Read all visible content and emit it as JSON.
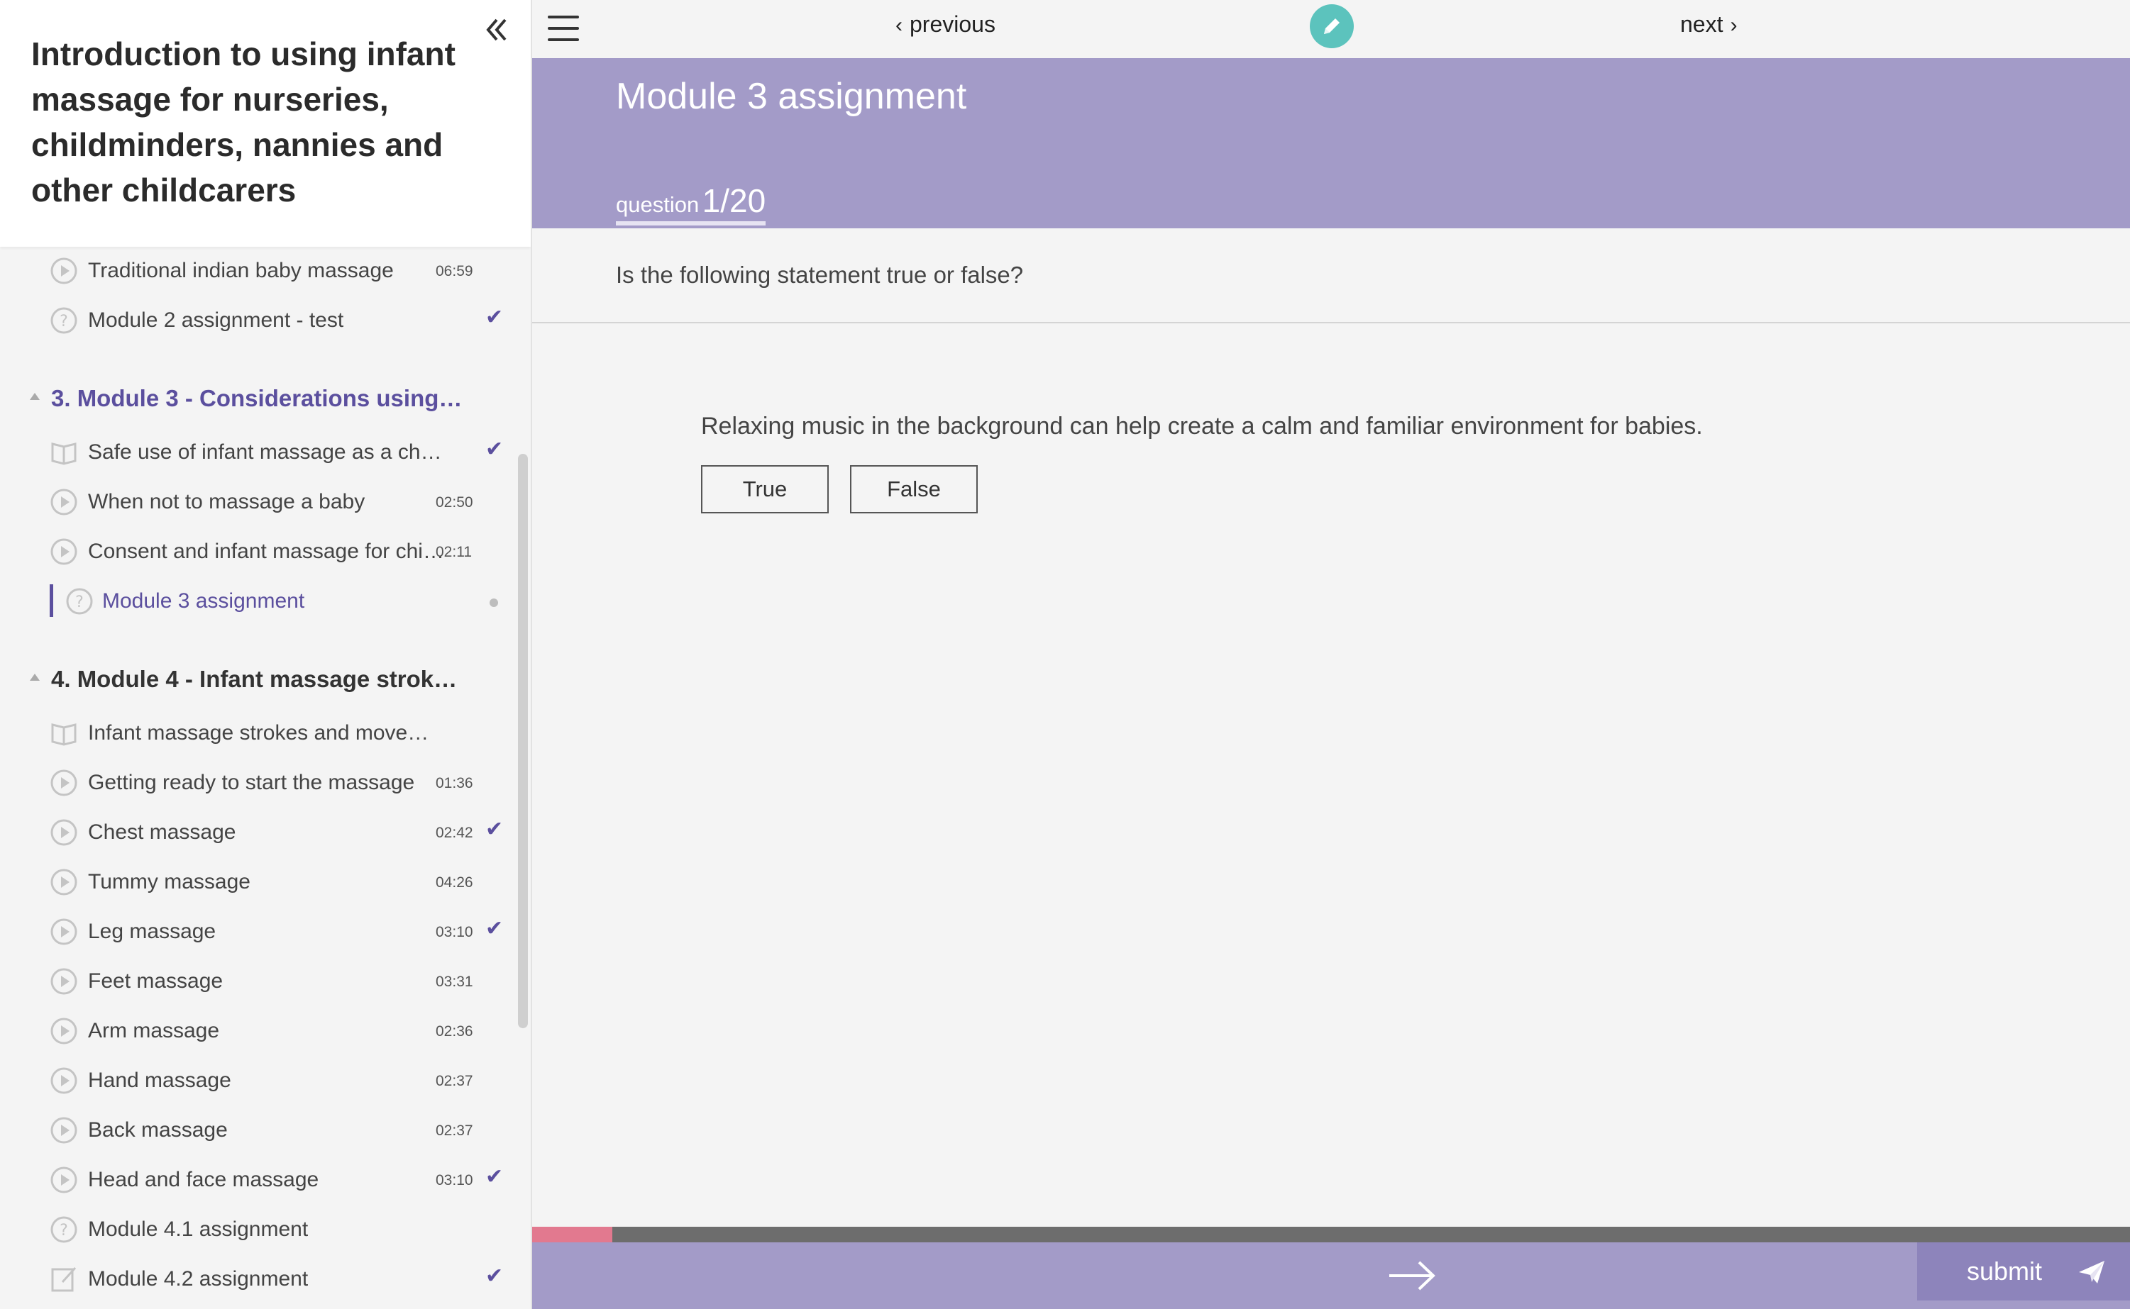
{
  "sidebar": {
    "course_title": "Introduction to using infant massage for nurseries, childminders, nannies and other childcarers",
    "items": [
      {
        "label": "Traditional indian baby massage",
        "duration": "06:59",
        "check": "",
        "icon": "play-circle-icon"
      },
      {
        "label": "Module 2 assignment - test",
        "duration": "",
        "check": "✔",
        "icon": "question-circle-icon"
      },
      {
        "label": "Safe use of infant massage as a ch…",
        "duration": "",
        "check": "✔",
        "icon": "book-icon"
      },
      {
        "label": "When not to massage a baby",
        "duration": "02:50",
        "check": "",
        "icon": "play-circle-icon"
      },
      {
        "label": "Consent and infant massage for chi…",
        "duration": "02:11",
        "check": "",
        "icon": "play-circle-icon"
      },
      {
        "label": "Module 3 assignment",
        "duration": "",
        "check": "",
        "icon": "question-circle-icon"
      },
      {
        "label": "Infant massage strokes and move…",
        "duration": "",
        "check": "",
        "icon": "book-icon"
      },
      {
        "label": "Getting ready to start the massage",
        "duration": "01:36",
        "check": "",
        "icon": "play-circle-icon"
      },
      {
        "label": "Chest massage",
        "duration": "02:42",
        "check": "✔",
        "icon": "play-circle-icon"
      },
      {
        "label": "Tummy massage",
        "duration": "04:26",
        "check": "",
        "icon": "play-circle-icon"
      },
      {
        "label": "Leg massage",
        "duration": "03:10",
        "check": "✔",
        "icon": "play-circle-icon"
      },
      {
        "label": "Feet massage",
        "duration": "03:31",
        "check": "",
        "icon": "play-circle-icon"
      },
      {
        "label": "Arm massage",
        "duration": "02:36",
        "check": "",
        "icon": "play-circle-icon"
      },
      {
        "label": "Hand massage",
        "duration": "02:37",
        "check": "",
        "icon": "play-circle-icon"
      },
      {
        "label": "Back massage",
        "duration": "02:37",
        "check": "",
        "icon": "play-circle-icon"
      },
      {
        "label": "Head and face massage",
        "duration": "03:10",
        "check": "✔",
        "icon": "play-circle-icon"
      },
      {
        "label": "Module 4.1 assignment",
        "duration": "",
        "check": "",
        "icon": "question-circle-icon"
      },
      {
        "label": "Module 4.2 assignment",
        "duration": "",
        "check": "✔",
        "icon": "edit-note-icon"
      }
    ],
    "sections": [
      {
        "title": "3. Module 3 - Considerations using…",
        "color": "#5b4f9e"
      },
      {
        "title": "4. Module 4 - Infant massage strok…",
        "color": "#333333"
      }
    ]
  },
  "nav": {
    "previous": "previous",
    "next": "next"
  },
  "main": {
    "title": "Module 3 assignment",
    "question_word": "question",
    "question_number": "1/20",
    "prompt": "Is the following statement true or false?",
    "statement": "Relaxing music in the background can help create a calm and familiar environment for babies.",
    "answers": {
      "true": "True",
      "false": "False"
    },
    "progress_fraction": 0.05,
    "submit": "submit"
  },
  "colors": {
    "accent": "#5b4f9e",
    "banner": "#a39bc8",
    "submit": "#8d84bb",
    "pencil": "#5cc3bd",
    "progress_fill": "#e2798f"
  }
}
